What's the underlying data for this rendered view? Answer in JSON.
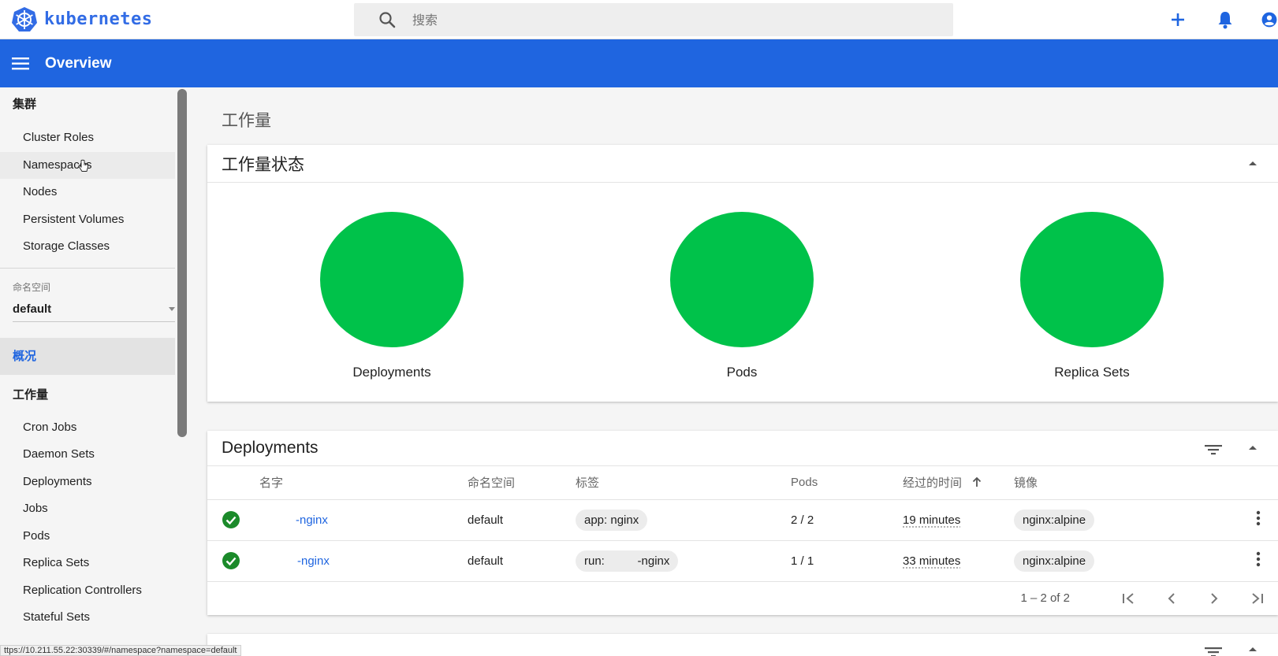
{
  "topbar": {
    "brand": "kubernetes",
    "search_placeholder": "搜索",
    "icons": [
      "add-icon",
      "notifications-icon",
      "account-icon"
    ]
  },
  "appbar": {
    "title": "Overview"
  },
  "sidebar": {
    "cluster_header": "集群",
    "cluster_items": [
      "Cluster Roles",
      "Namespaces",
      "Nodes",
      "Persistent Volumes",
      "Storage Classes"
    ],
    "namespace_label": "命名空间",
    "namespace_value": "default",
    "overview": "概况",
    "workloads_header": "工作量",
    "workload_items": [
      "Cron Jobs",
      "Daemon Sets",
      "Deployments",
      "Jobs",
      "Pods",
      "Replica Sets",
      "Replication Controllers",
      "Stateful Sets"
    ]
  },
  "main": {
    "page_title": "工作量",
    "status_card": {
      "title": "工作量状态",
      "items": [
        {
          "label": "Deployments",
          "color": "#00c24a"
        },
        {
          "label": "Pods",
          "color": "#00c24a"
        },
        {
          "label": "Replica Sets",
          "color": "#00c24a"
        }
      ]
    },
    "deployments_card": {
      "title": "Deployments",
      "columns": [
        "名字",
        "命名空间",
        "标签",
        "Pods",
        "经过的时间",
        "镜像"
      ],
      "rows": [
        {
          "name": "-nginx",
          "namespace": "default",
          "label": "app: nginx",
          "pods": "2 / 2",
          "age": "19 minutes",
          "image": "nginx:alpine"
        },
        {
          "name": "-nginx",
          "namespace": "default",
          "label": "run:          -nginx",
          "pods": "1 / 1",
          "age": "33 minutes",
          "image": "nginx:alpine"
        }
      ],
      "pagination": "1 – 2 of 2"
    }
  },
  "browser_status_url": "ttps://10.211.55.22:30339/#/namespace?namespace=default",
  "colors": {
    "primary": "#1f65e0",
    "brand": "#326ce5",
    "success": "#00c24a",
    "ok_check": "#1b8a2a"
  }
}
